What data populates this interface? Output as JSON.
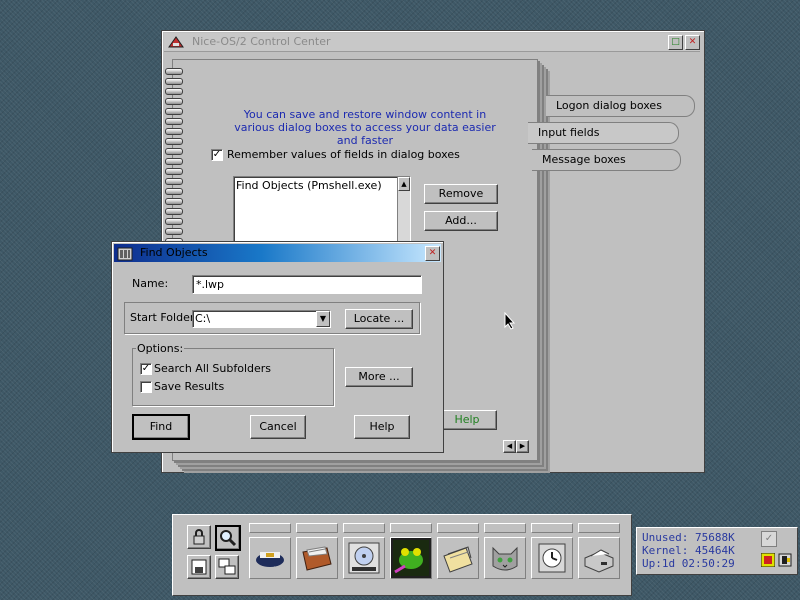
{
  "control_center": {
    "title": "Nice-OS/2 Control Center",
    "info_text": "You can save and restore window content in various dialog boxes to access your data easier and faster",
    "remember_label": "Remember values of fields in dialog boxes",
    "remember_checked": true,
    "list_items": [
      "Find Objects (Pmshell.exe)"
    ],
    "remove_label": "Remove",
    "add_label": "Add...",
    "help_label": "Help",
    "tabs": [
      "Logon dialog boxes",
      "Input fields",
      "Message boxes"
    ],
    "selected_tab": "Input fields"
  },
  "find_objects": {
    "title": "Find Objects",
    "name_label": "Name:",
    "name_value": "*.lwp",
    "start_folder_label": "Start Folder:",
    "start_folder_value": "C:\\",
    "locate_label": "Locate ...",
    "options_label": "Options:",
    "search_subfolders_label": "Search All Subfolders",
    "search_subfolders_checked": true,
    "save_results_label": "Save Results",
    "save_results_checked": false,
    "more_label": "More ...",
    "find_label": "Find",
    "cancel_label": "Cancel",
    "help_label": "Help"
  },
  "taskbar": {
    "icons": [
      "lock-icon",
      "find-icon",
      "disk-icon",
      "windows-icon",
      "captain-icon",
      "drawer-icon",
      "cd-player-icon",
      "frog-game-icon",
      "folders-icon",
      "cat-icon",
      "clock-icon",
      "printer-icon"
    ]
  },
  "system_monitor": {
    "unused": "Unused:  75688K",
    "kernel": "Kernel:  45464K",
    "uptime": "Up:1d  02:50:29"
  }
}
